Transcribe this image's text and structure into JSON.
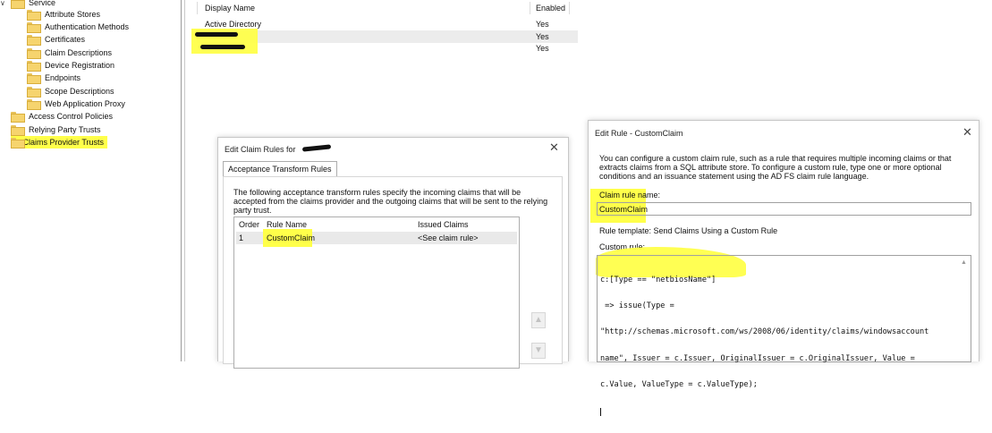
{
  "tree": {
    "items": [
      {
        "label": "Service",
        "indent": 0,
        "type": "expander"
      },
      {
        "label": "Attribute Stores",
        "indent": 1
      },
      {
        "label": "Authentication Methods",
        "indent": 1
      },
      {
        "label": "Certificates",
        "indent": 1
      },
      {
        "label": "Claim Descriptions",
        "indent": 1
      },
      {
        "label": "Device Registration",
        "indent": 1
      },
      {
        "label": "Endpoints",
        "indent": 1
      },
      {
        "label": "Scope Descriptions",
        "indent": 1
      },
      {
        "label": "Web Application Proxy",
        "indent": 1
      },
      {
        "label": "Access Control Policies",
        "indent": 0
      },
      {
        "label": "Relying Party Trusts",
        "indent": 0
      },
      {
        "label": "Claims Provider Trusts",
        "indent": 0,
        "selected": true
      }
    ]
  },
  "trust_list": {
    "columns": [
      "Display Name",
      "Enabled"
    ],
    "rows": [
      {
        "name": "Active Directory",
        "enabled": "Yes"
      },
      {
        "name": "",
        "enabled": "Yes"
      },
      {
        "name": "",
        "enabled": "Yes"
      }
    ]
  },
  "claim_rules_dialog": {
    "title": "Edit Claim Rules for",
    "tab": "Acceptance Transform Rules",
    "description": "The following acceptance transform rules specify the incoming claims that will be accepted from the claims provider and the outgoing claims that will be sent to the relying party trust.",
    "columns": {
      "order": "Order",
      "rule_name": "Rule Name",
      "issued": "Issued Claims"
    },
    "rows": [
      {
        "order": "1",
        "rule_name": "CustomClaim",
        "issued": "<See claim rule>"
      }
    ]
  },
  "edit_rule_dialog": {
    "title": "Edit Rule - CustomClaim",
    "description": "You can configure a custom claim rule, such as a rule that requires multiple incoming claims or that extracts claims from a SQL attribute store. To configure a custom rule, type one or more optional conditions and an issuance statement using the AD FS claim rule language.",
    "rule_name_label": "Claim rule name:",
    "rule_name_value": "CustomClaim",
    "template_label": "Rule template: Send Claims Using a Custom Rule",
    "custom_rule_label": "Custom rule:",
    "custom_rule_lines": [
      "c:[Type == \"netbiosName\"]",
      " => issue(Type =",
      "\"http://schemas.microsoft.com/ws/2008/06/identity/claims/windowsaccount",
      "name\", Issuer = c.Issuer, OriginalIssuer = c.OriginalIssuer, Value =",
      "c.Value, ValueType = c.ValueType);"
    ]
  },
  "colors": {
    "highlight": "#ffff4a",
    "folder": "#f6d46e"
  }
}
